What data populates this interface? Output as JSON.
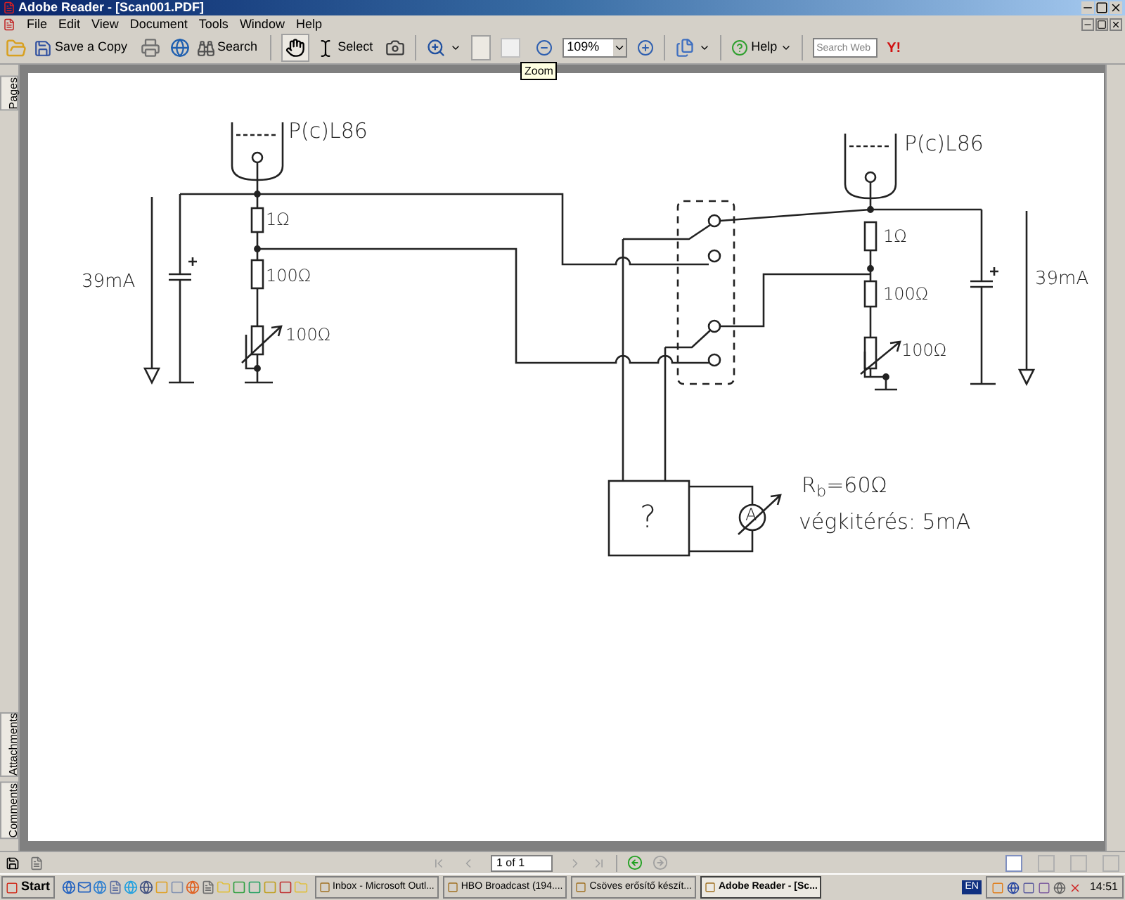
{
  "window": {
    "title": "Adobe Reader - [Scan001.PDF]"
  },
  "menu": [
    "File",
    "Edit",
    "View",
    "Document",
    "Tools",
    "Window",
    "Help"
  ],
  "toolbar": {
    "save_copy": "Save a Copy",
    "search": "Search",
    "hand_selected": true,
    "select": "Select",
    "fit_page_selected": true,
    "zoom": "109%",
    "help": "Help",
    "search_placeholder": "Search Web",
    "logo": "Y!",
    "tooltip": "Zoom"
  },
  "side_tabs": [
    "Pages",
    "Attachments",
    "Comments"
  ],
  "diagram": {
    "labels": [
      {
        "text": "P(c)L86"
      },
      {
        "text": "1Ω"
      },
      {
        "text": "100Ω"
      },
      {
        "text": "100Ω"
      },
      {
        "text": "39mA"
      },
      {
        "text": "P(c)L86"
      },
      {
        "text": "1Ω"
      },
      {
        "text": "100Ω"
      },
      {
        "text": "100Ω"
      },
      {
        "text": "39mA"
      },
      {
        "text": "?"
      },
      {
        "text": "A"
      },
      {
        "text": "R$_{b}$=60Ω"
      },
      {
        "text": "végkitérés: 5mA"
      }
    ]
  },
  "navigation": {
    "page": "1 of 1"
  },
  "taskbar": {
    "start": "Start",
    "tasks": [
      {
        "label": "Inbox - Microsoft Outl...",
        "selected": false
      },
      {
        "label": "HBO Broadcast (194....",
        "selected": false
      },
      {
        "label": "Csöves erősítő készít...",
        "selected": false
      },
      {
        "label": "Adobe Reader - [Sc...",
        "selected": true
      }
    ],
    "language": "EN",
    "clock": "14:51"
  }
}
